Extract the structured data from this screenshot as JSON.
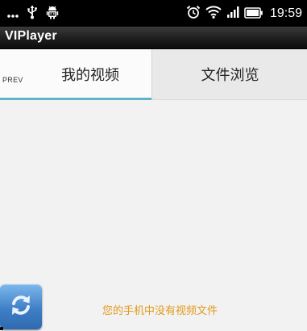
{
  "status_bar": {
    "time": "19:59",
    "left_icons": [
      "more-dots-icon",
      "usb-icon",
      "android-debug-icon"
    ],
    "right_icons": [
      "alarm-icon",
      "wifi-icon",
      "signal-icon",
      "battery-icon"
    ]
  },
  "app": {
    "title": "VIPlayer"
  },
  "tabs": [
    {
      "label": "我的视频",
      "active": true,
      "prev_label": "PREV"
    },
    {
      "label": "文件浏览",
      "active": false
    }
  ],
  "content": {
    "empty_message": "您的手机中没有视频文件"
  },
  "refresh_button": {
    "icon": "refresh-icon"
  },
  "colors": {
    "accent": "#5fb3c9",
    "message": "#e19a1a",
    "refresh_button": "#3f7fc6"
  }
}
